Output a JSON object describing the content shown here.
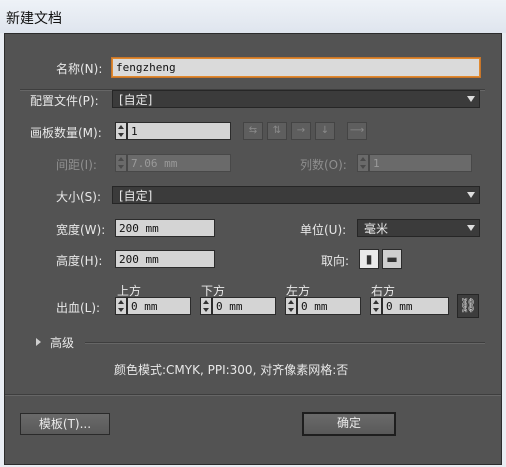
{
  "window": {
    "title": "新建文档"
  },
  "name": {
    "label": "名称(N):",
    "value": "fengzheng"
  },
  "profile": {
    "label": "配置文件(P):",
    "value": "[自定]"
  },
  "artboards": {
    "label": "画板数量(M):",
    "value": "1"
  },
  "spacing": {
    "label": "间距(I):",
    "value": "7.06 mm"
  },
  "columns": {
    "label": "列数(O):",
    "value": "1"
  },
  "size": {
    "label": "大小(S):",
    "value": "[自定]"
  },
  "width": {
    "label": "宽度(W):",
    "value": "200 mm"
  },
  "units": {
    "label": "单位(U):",
    "value": "毫米"
  },
  "height": {
    "label": "高度(H):",
    "value": "200 mm"
  },
  "orientation": {
    "label": "取向:"
  },
  "bleed": {
    "label": "出血(L):",
    "top": {
      "label": "上方",
      "value": "0 mm"
    },
    "bottom": {
      "label": "下方",
      "value": "0 mm"
    },
    "left": {
      "label": "左方",
      "value": "0 mm"
    },
    "right": {
      "label": "右方",
      "value": "0 mm"
    }
  },
  "advanced": {
    "label": "高级"
  },
  "summary": "颜色模式:CMYK, PPI:300, 对齐像素网格:否",
  "buttons": {
    "templates": "模板(T)...",
    "ok": "确定"
  },
  "icons": {
    "arrange_grid_row": "grid-by-row-icon",
    "arrange_grid_col": "grid-by-column-icon",
    "arrange_row": "arrange-by-row-icon",
    "arrange_col": "arrange-by-column-icon",
    "direction": "right-arrow-icon",
    "portrait": "portrait-icon",
    "landscape": "landscape-icon",
    "link": "chain-link-icon"
  },
  "colors": {
    "dialog_bg": "#535353",
    "focus": "#e0892f"
  }
}
